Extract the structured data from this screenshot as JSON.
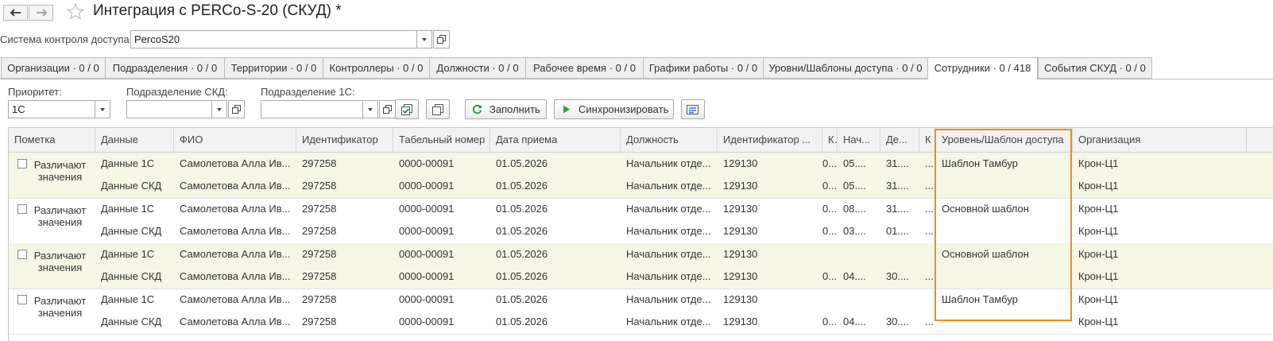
{
  "window": {
    "title": "Интеграция с PERCo-S-20 (СКУД) *"
  },
  "access_system": {
    "label": "Система контроля доступа:",
    "value": "PercoS20"
  },
  "tabs": [
    {
      "label": "Организации · 0 / 0"
    },
    {
      "label": "Подразделения · 0 / 0"
    },
    {
      "label": "Территории · 0 / 0"
    },
    {
      "label": "Контроллеры · 0 / 0"
    },
    {
      "label": "Должности · 0 / 0"
    },
    {
      "label": "Рабочее время · 0 / 0"
    },
    {
      "label": "Графики работы · 0 / 0"
    },
    {
      "label": "Уровни/Шаблоны доступа · 0 / 0"
    },
    {
      "label": "Сотрудники · 0 / 418"
    },
    {
      "label": "События СКУД · 0 / 0"
    }
  ],
  "filters": {
    "priority_label": "Приоритет:",
    "priority_value": "1С",
    "skd_dept_label": "Подразделение СКД:",
    "skd_dept_value": "",
    "dept_1c_label": "Подразделение 1С:",
    "dept_1c_value": ""
  },
  "toolbar": {
    "fill_label": "Заполнить",
    "sync_label": "Синхронизировать"
  },
  "columns": [
    "Пометка",
    "Данные",
    "ФИО",
    "Идентификатор",
    "Табельный номер",
    "Дата приема",
    "Должность",
    "Идентификатор ...",
    "К...",
    "Нач...",
    "Де...",
    "К",
    "Уровень/Шаблон доступа",
    "Организация"
  ],
  "rows": [
    {
      "mark": "Различают значения",
      "lines": [
        {
          "data": "Данные 1С",
          "fio": "Самолетова Алла Ив...",
          "id": "297258",
          "tab": "0000-00091",
          "date": "01.05.2026",
          "pos": "Начальник отде...",
          "id2": "129130",
          "k": "0...",
          "start": "05....",
          "de": "31....",
          "k2": "...",
          "level": "Шаблон Тамбур",
          "org": "Крон-Ц1"
        },
        {
          "data": "Данные СКД",
          "fio": "Самолетова Алла Ив...",
          "id": "297258",
          "tab": "0000-00091",
          "date": "01.05.2026",
          "pos": "Начальник отде...",
          "id2": "129130",
          "k": "0...",
          "start": "05....",
          "de": "31....",
          "k2": "...",
          "level": "",
          "org": "Крон-Ц1"
        }
      ]
    },
    {
      "mark": "Различают значения",
      "lines": [
        {
          "data": "Данные 1С",
          "fio": "Самолетова Алла Ив...",
          "id": "297258",
          "tab": "0000-00091",
          "date": "01.05.2026",
          "pos": "Начальник отде...",
          "id2": "129130",
          "k": "0...",
          "start": "08....",
          "de": "31....",
          "k2": "...",
          "level": "Основной шаблон",
          "org": "Крон-Ц1"
        },
        {
          "data": "Данные СКД",
          "fio": "Самолетова Алла Ив...",
          "id": "297258",
          "tab": "0000-00091",
          "date": "01.05.2026",
          "pos": "Начальник отде...",
          "id2": "129130",
          "k": "0...",
          "start": "03....",
          "de": "01....",
          "k2": "...",
          "level": "",
          "org": "Крон-Ц1"
        }
      ]
    },
    {
      "mark": "Различают значения",
      "lines": [
        {
          "data": "Данные 1С",
          "fio": "Самолетова Алла Ив...",
          "id": "297258",
          "tab": "0000-00091",
          "date": "01.05.2026",
          "pos": "Начальник отде...",
          "id2": "129130",
          "k": "",
          "start": "",
          "de": "",
          "k2": "",
          "level": "Основной шаблон",
          "org": "Крон-Ц1"
        },
        {
          "data": "Данные СКД",
          "fio": "Самолетова Алла Ив...",
          "id": "297258",
          "tab": "0000-00091",
          "date": "01.05.2026",
          "pos": "Начальник отде...",
          "id2": "129130",
          "k": "0...",
          "start": "04....",
          "de": "30....",
          "k2": "...",
          "level": "",
          "org": "Крон-Ц1"
        }
      ]
    },
    {
      "mark": "Различают значения",
      "lines": [
        {
          "data": "Данные 1С",
          "fio": "Самолетова Алла Ив...",
          "id": "297258",
          "tab": "0000-00091",
          "date": "01.05.2026",
          "pos": "Начальник отде...",
          "id2": "129130",
          "k": "",
          "start": "",
          "de": "",
          "k2": "",
          "level": "Шаблон Тамбур",
          "org": "Крон-Ц1"
        },
        {
          "data": "Данные СКД",
          "fio": "Самолетова Алла Ив...",
          "id": "297258",
          "tab": "0000-00091",
          "date": "01.05.2026",
          "pos": "Начальник отде...",
          "id2": "129130",
          "k": "0...",
          "start": "04....",
          "de": "30....",
          "k2": "...",
          "level": "",
          "org": "Крон-Ц1"
        }
      ]
    }
  ],
  "colors": {
    "highlight_row": "#f6f6e6",
    "highlight_border": "#f08c1e",
    "sync_icon": "#22a838",
    "fill_icon": "#2e8b3a"
  }
}
